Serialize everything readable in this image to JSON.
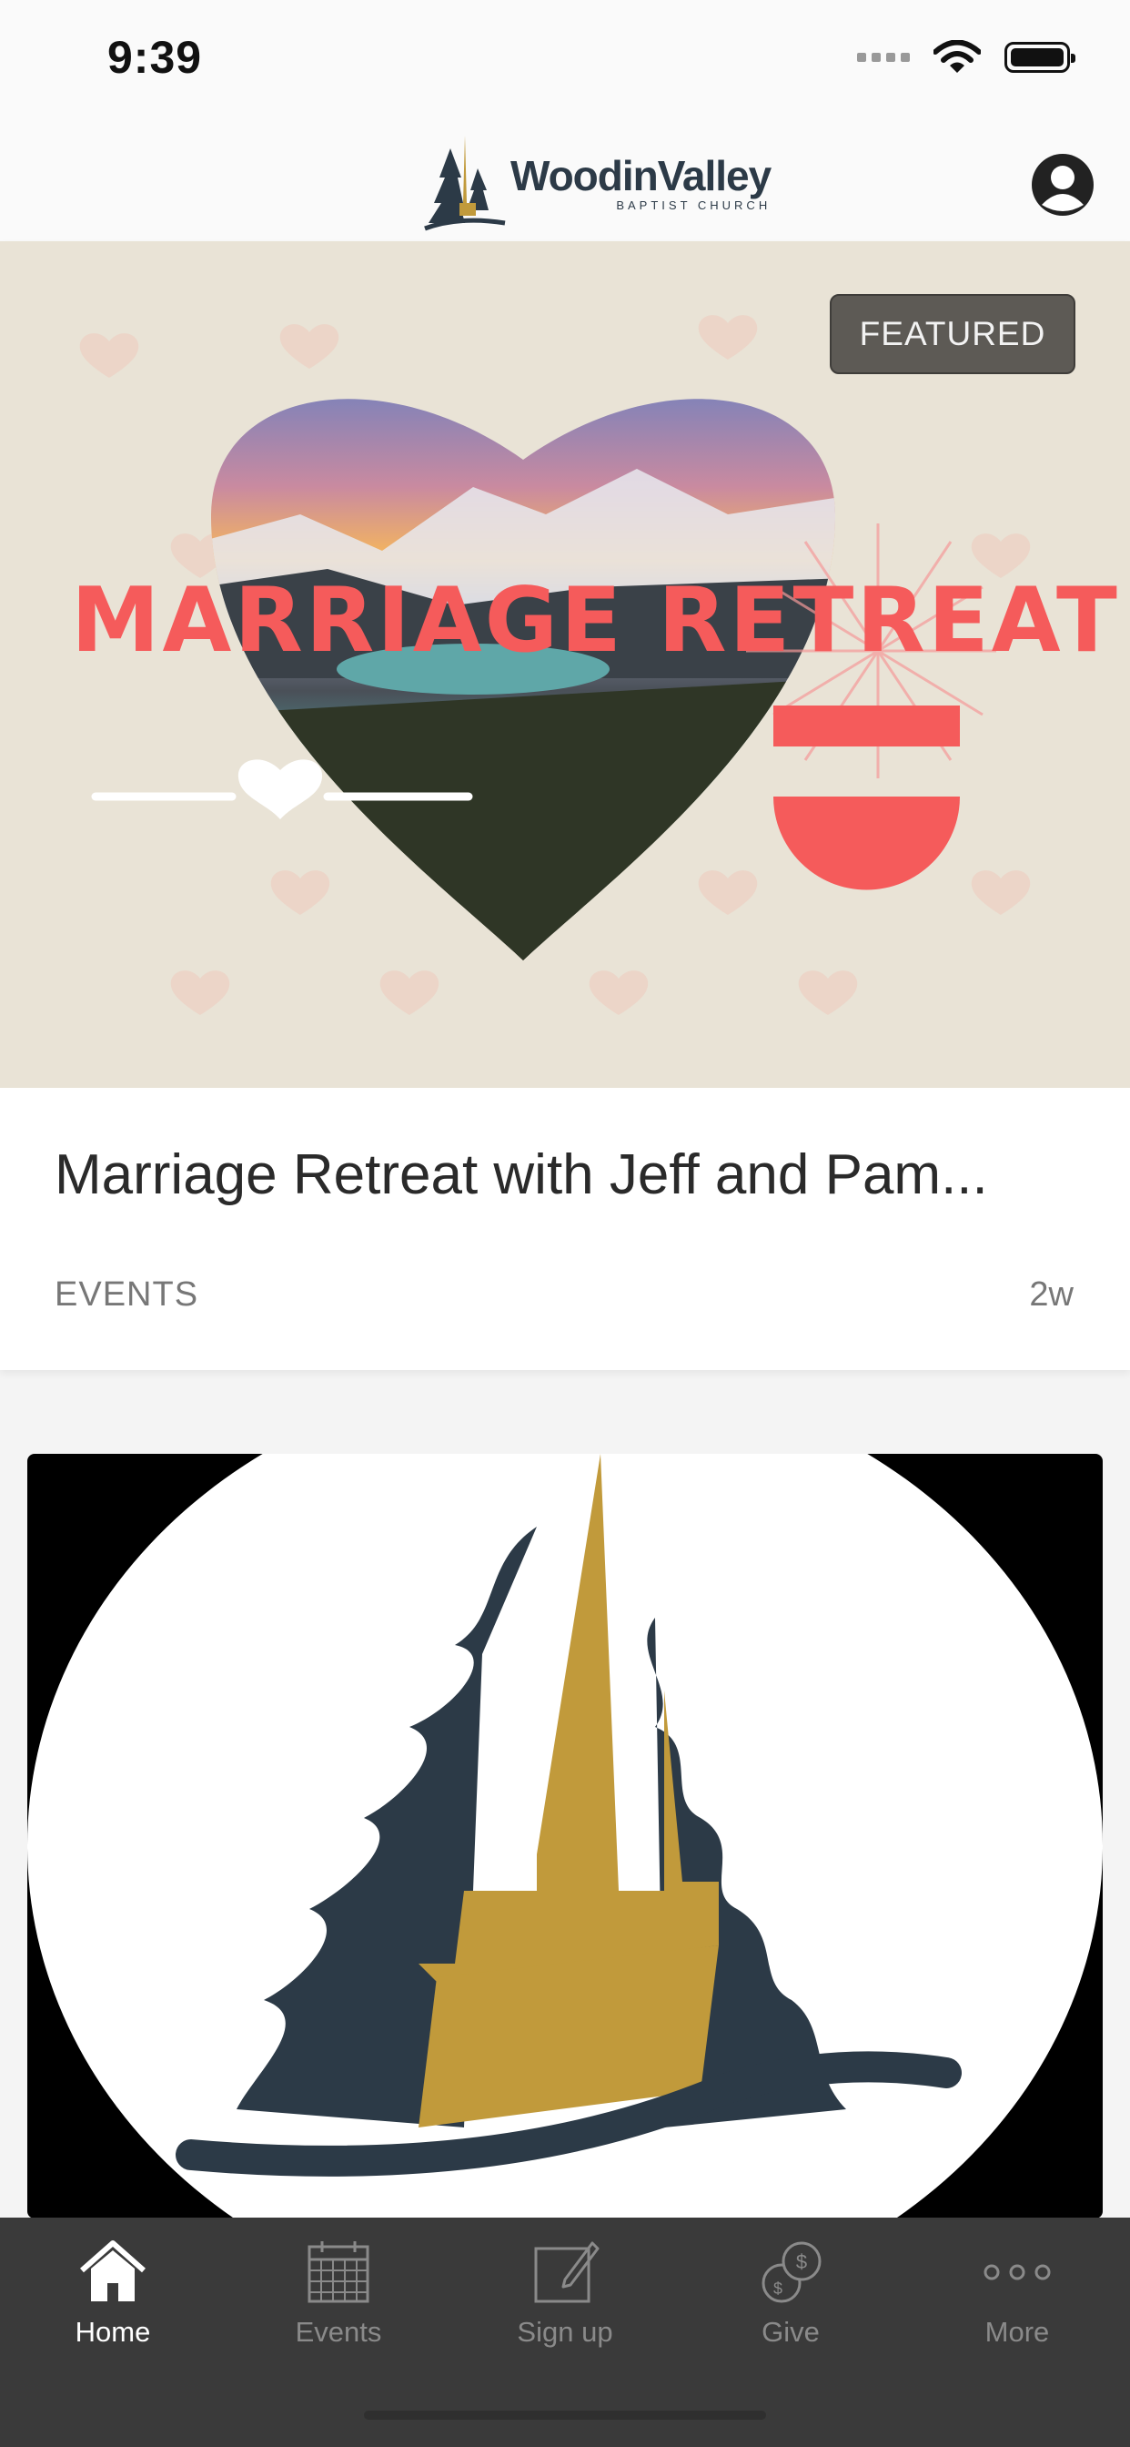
{
  "status_bar": {
    "time": "9:39"
  },
  "header": {
    "logo_main": "WoodinValley",
    "logo_sub": "BAPTIST CHURCH"
  },
  "featured_card": {
    "badge": "FEATURED",
    "image_title": "MARRIAGE RETREAT",
    "title": "Marriage Retreat with Jeff and Pam...",
    "category": "EVENTS",
    "age": "2w"
  },
  "tab_bar": {
    "items": [
      {
        "label": "Home",
        "icon": "home-icon",
        "active": true
      },
      {
        "label": "Events",
        "icon": "calendar-icon",
        "active": false
      },
      {
        "label": "Sign up",
        "icon": "edit-icon",
        "active": false
      },
      {
        "label": "Give",
        "icon": "coins-icon",
        "active": false
      },
      {
        "label": "More",
        "icon": "more-icon",
        "active": false
      }
    ]
  },
  "colors": {
    "accent_red": "#f55b5b",
    "logo_gold": "#c19a3b",
    "logo_navy": "#2c3a47",
    "tab_bar": "#3a3a3a"
  }
}
